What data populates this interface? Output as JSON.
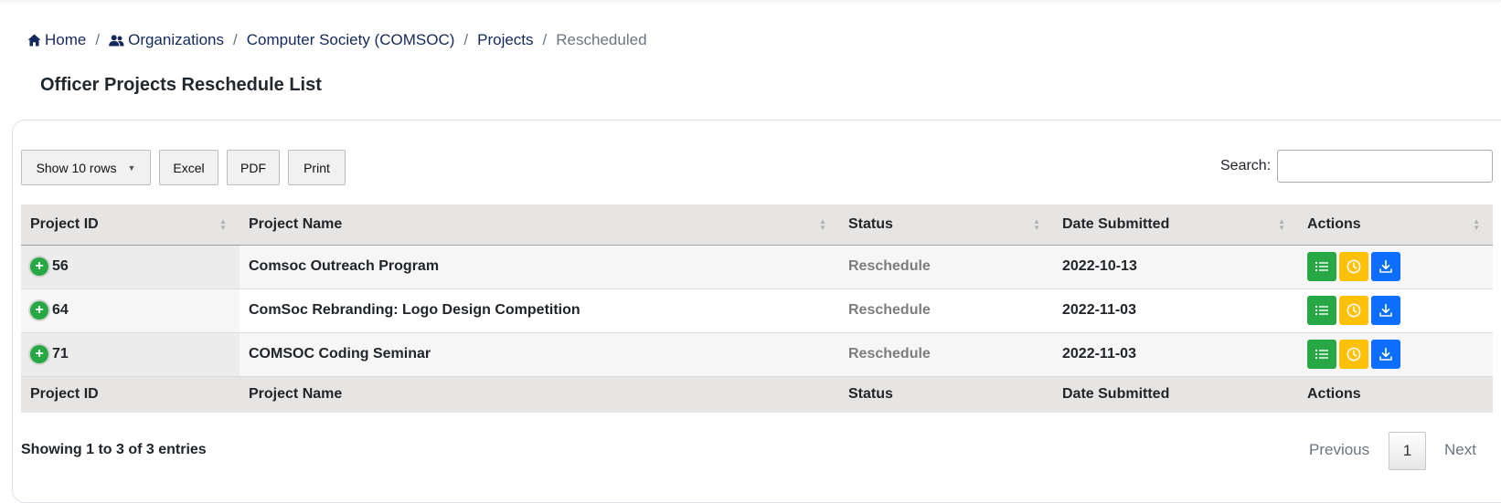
{
  "breadcrumb": {
    "home": "Home",
    "organizations": "Organizations",
    "org": "Computer Society (COMSOC)",
    "projects": "Projects",
    "current": "Rescheduled",
    "separator": "/"
  },
  "page_title": "Officer Projects Reschedule List",
  "toolbar": {
    "show_rows": "Show 10 rows",
    "excel": "Excel",
    "pdf": "PDF",
    "print": "Print",
    "search_label": "Search:",
    "search_value": ""
  },
  "table": {
    "headers": [
      "Project ID",
      "Project Name",
      "Status",
      "Date Submitted",
      "Actions"
    ],
    "rows": [
      {
        "id": "56",
        "name": "Comsoc Outreach Program",
        "status": "Reschedule",
        "date": "2022-10-13"
      },
      {
        "id": "64",
        "name": "ComSoc Rebranding: Logo Design Competition",
        "status": "Reschedule",
        "date": "2022-11-03"
      },
      {
        "id": "71",
        "name": "COMSOC Coding Seminar",
        "status": "Reschedule",
        "date": "2022-11-03"
      }
    ],
    "expand_symbol": "+",
    "action_icons": [
      "list-icon",
      "clock-icon",
      "download-icon"
    ]
  },
  "footer": {
    "info": "Showing 1 to 3 of 3 entries",
    "previous": "Previous",
    "current_page": "1",
    "next": "Next"
  },
  "colors": {
    "breadcrumb_link": "#13285c",
    "header_bg": "#e6e5e3",
    "green": "#28a745",
    "yellow": "#ffc107",
    "blue": "#0d6efd"
  }
}
